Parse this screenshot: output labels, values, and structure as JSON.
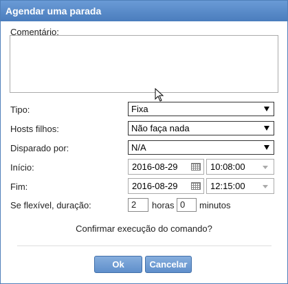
{
  "dialog": {
    "title": "Agendar uma parada"
  },
  "comment": {
    "label": "Comentário:",
    "value": ""
  },
  "tipo": {
    "label": "Tipo:",
    "value": "Fixa"
  },
  "hosts": {
    "label": "Hosts filhos:",
    "value": "Não faça nada"
  },
  "disparado": {
    "label": "Disparado por:",
    "value": "N/A"
  },
  "inicio": {
    "label": "Início:",
    "date": "2016-08-29",
    "time": "10:08:00"
  },
  "fim": {
    "label": "Fim:",
    "date": "2016-08-29",
    "time": "12:15:00"
  },
  "duracao": {
    "label": "Se flexível, duração:",
    "hours_value": "2",
    "hours_unit": "horas",
    "minutes_value": "0",
    "minutes_unit": "minutos"
  },
  "confirm_text": "Confirmar execução do comando?",
  "buttons": {
    "ok": "Ok",
    "cancel": "Cancelar"
  },
  "colors": {
    "titlebar": "#4a7dbd",
    "button": "#6d98d0"
  },
  "icons": [
    "calendar-icon",
    "dropdown-arrow-icon",
    "mouse-cursor-icon"
  ]
}
